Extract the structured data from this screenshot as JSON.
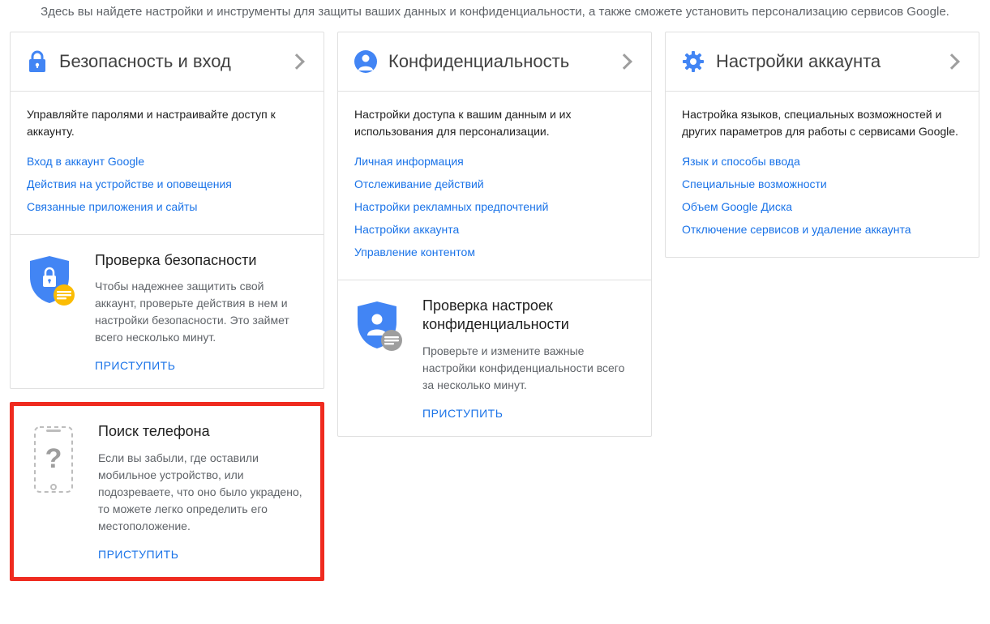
{
  "intro": "Здесь вы найдете настройки и инструменты для защиты ваших данных и конфиденциальности, а также сможете установить персонализацию сервисов Google.",
  "columns": {
    "security": {
      "title": "Безопасность и вход",
      "desc": "Управляйте паролями и настраивайте доступ к аккаунту.",
      "links": [
        "Вход в аккаунт Google",
        "Действия на устройстве и оповещения",
        "Связанные приложения и сайты"
      ],
      "checkup": {
        "title": "Проверка безопасности",
        "desc": "Чтобы надежнее защитить свой аккаунт, проверьте действия в нем и настройки безопасности. Это займет всего несколько минут.",
        "cta": "ПРИСТУПИТЬ"
      },
      "findphone": {
        "title": "Поиск телефона",
        "desc": "Если вы забыли, где оставили мобильное устройство, или подозреваете, что оно было украдено, то можете легко определить его местоположение.",
        "cta": "ПРИСТУПИТЬ"
      }
    },
    "privacy": {
      "title": "Конфиденциальность",
      "desc": "Настройки доступа к вашим данным и их использования для персонализации.",
      "links": [
        "Личная информация",
        "Отслеживание действий",
        "Настройки рекламных предпочтений",
        "Настройки аккаунта",
        "Управление контентом"
      ],
      "checkup": {
        "title": "Проверка настроек конфиденциальности",
        "desc": "Проверьте и измените важные настройки конфиденциальности всего за несколько минут.",
        "cta": "ПРИСТУПИТЬ"
      }
    },
    "account": {
      "title": "Настройки аккаунта",
      "desc": "Настройка языков, специальных возможностей и других параметров для работы с сервисами Google.",
      "links": [
        "Язык и способы ввода",
        "Специальные возможности",
        "Объем Google Диска",
        "Отключение сервисов и удаление аккаунта"
      ]
    }
  }
}
